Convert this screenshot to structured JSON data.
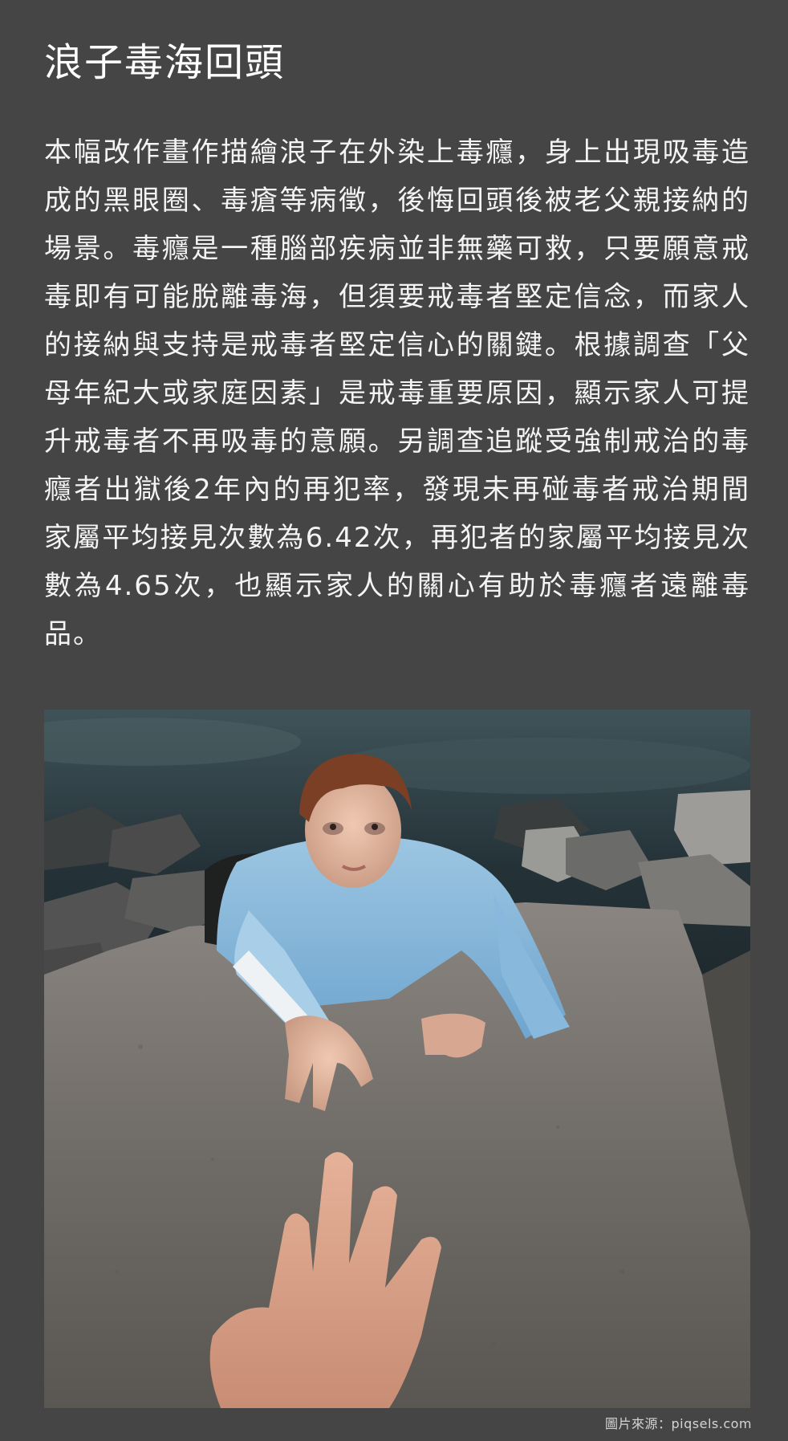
{
  "article": {
    "title": "浪子毒海回頭",
    "body": "本幅改作畫作描繪浪子在外染上毒癮，身上出現吸毒造成的黑眼圈、毒瘡等病徵，後悔回頭後被老父親接納的場景。毒癮是一種腦部疾病並非無藥可救，只要願意戒毒即有可能脫離毒海，但須要戒毒者堅定信念，而家人的接納與支持是戒毒者堅定信心的關鍵。根據調查「父母年紀大或家庭因素」是戒毒重要原因，顯示家人可提升戒毒者不再吸毒的意願。另調查追蹤受強制戒治的毒癮者出獄後2年內的再犯率，發現未再碰毒者戒治期間家屬平均接見次數為6.42次，再犯者的家屬平均接見次數為4.65次，也顯示家人的關心有助於毒癮者遠離毒品。"
  },
  "image": {
    "credit": "圖片來源：piqsels.com"
  }
}
